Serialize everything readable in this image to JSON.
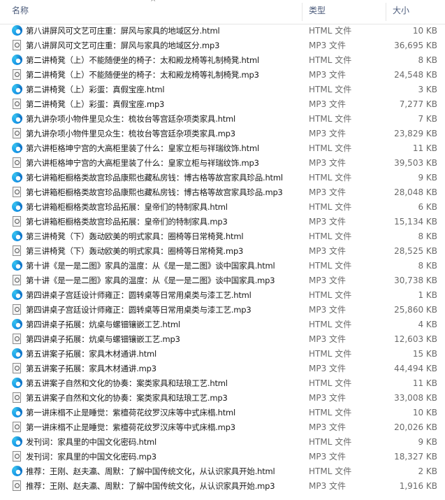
{
  "header": {
    "name": "名称",
    "type": "类型",
    "size": "大小",
    "sort_arrow": "^"
  },
  "files": [
    {
      "name": "第八讲屏风可文艺可庄重：屏风与家具的地域区分.html",
      "type": "HTML 文件",
      "size": "10 KB",
      "icon": "edge-html-icon"
    },
    {
      "name": "第八讲屏风可文艺可庄重：屏风与家具的地域区分.mp3",
      "type": "MP3 文件",
      "size": "36,695 KB",
      "icon": "mp3-file-icon"
    },
    {
      "name": "第二讲椅凳（上）不能随便坐的椅子：太和殿龙椅等礼制椅凳.html",
      "type": "HTML 文件",
      "size": "8 KB",
      "icon": "edge-html-icon"
    },
    {
      "name": "第二讲椅凳（上）不能随便坐的椅子：太和殿龙椅等礼制椅凳.mp3",
      "type": "MP3 文件",
      "size": "24,548 KB",
      "icon": "mp3-file-icon"
    },
    {
      "name": "第二讲椅凳（上）彩蛋：真假宝座.html",
      "type": "HTML 文件",
      "size": "3 KB",
      "icon": "edge-html-icon"
    },
    {
      "name": "第二讲椅凳（上）彩蛋：真假宝座.mp3",
      "type": "MP3 文件",
      "size": "7,277 KB",
      "icon": "mp3-file-icon"
    },
    {
      "name": "第九讲杂项小物件里见众生：梳妆台等宫廷杂项类家具.html",
      "type": "HTML 文件",
      "size": "7 KB",
      "icon": "edge-html-icon"
    },
    {
      "name": "第九讲杂项小物件里见众生：梳妆台等宫廷杂项类家具.mp3",
      "type": "MP3 文件",
      "size": "23,829 KB",
      "icon": "mp3-file-icon"
    },
    {
      "name": "第六讲柜格坤宁宫的大高柜里装了什么：皇家立柜与祥瑞纹饰.html",
      "type": "HTML 文件",
      "size": "11 KB",
      "icon": "edge-html-icon"
    },
    {
      "name": "第六讲柜格坤宁宫的大高柜里装了什么：皇家立柜与祥瑞纹饰.mp3",
      "type": "MP3 文件",
      "size": "39,503 KB",
      "icon": "mp3-file-icon"
    },
    {
      "name": "第七讲箱柜橱格类故宫珍品康熙也藏私房钱：博古格等故宫家具珍品.html",
      "type": "HTML 文件",
      "size": "9 KB",
      "icon": "edge-html-icon"
    },
    {
      "name": "第七讲箱柜橱格类故宫珍品康熙也藏私房钱：博古格等故宫家具珍品.mp3",
      "type": "MP3 文件",
      "size": "28,048 KB",
      "icon": "mp3-file-icon"
    },
    {
      "name": "第七讲箱柜橱格类故宫珍品拓展：皇帝们的特制家具.html",
      "type": "HTML 文件",
      "size": "6 KB",
      "icon": "edge-html-icon"
    },
    {
      "name": "第七讲箱柜橱格类故宫珍品拓展：皇帝们的特制家具.mp3",
      "type": "MP3 文件",
      "size": "15,134 KB",
      "icon": "mp3-file-icon"
    },
    {
      "name": "第三讲椅凳（下）轰动欧美的明式家具：圈椅等日常椅凳.html",
      "type": "HTML 文件",
      "size": "8 KB",
      "icon": "edge-html-icon"
    },
    {
      "name": "第三讲椅凳（下）轰动欧美的明式家具：圈椅等日常椅凳.mp3",
      "type": "MP3 文件",
      "size": "28,525 KB",
      "icon": "mp3-file-icon"
    },
    {
      "name": "第十讲《是一是二图》家具的温度：从《是一是二图》谈中国家具.html",
      "type": "HTML 文件",
      "size": "8 KB",
      "icon": "edge-html-icon"
    },
    {
      "name": "第十讲《是一是二图》家具的温度：从《是一是二图》谈中国家具.mp3",
      "type": "MP3 文件",
      "size": "30,738 KB",
      "icon": "mp3-file-icon"
    },
    {
      "name": "第四讲桌子宫廷设计师雍正：圆转桌等日常用桌类与漆工艺.html",
      "type": "HTML 文件",
      "size": "1 KB",
      "icon": "edge-html-icon"
    },
    {
      "name": "第四讲桌子宫廷设计师雍正：圆转桌等日常用桌类与漆工艺.mp3",
      "type": "MP3 文件",
      "size": "25,860 KB",
      "icon": "mp3-file-icon"
    },
    {
      "name": "第四讲桌子拓展：炕桌与螺钿镶嵌工艺.html",
      "type": "HTML 文件",
      "size": "4 KB",
      "icon": "edge-html-icon"
    },
    {
      "name": "第四讲桌子拓展：炕桌与螺钿镶嵌工艺.mp3",
      "type": "MP3 文件",
      "size": "12,603 KB",
      "icon": "mp3-file-icon"
    },
    {
      "name": "第五讲案子拓展：家具木材通讲.html",
      "type": "HTML 文件",
      "size": "15 KB",
      "icon": "edge-html-icon"
    },
    {
      "name": "第五讲案子拓展：家具木材通讲.mp3",
      "type": "MP3 文件",
      "size": "44,494 KB",
      "icon": "mp3-file-icon"
    },
    {
      "name": "第五讲案子自然和文化的协奏：案类家具和珐琅工艺.html",
      "type": "HTML 文件",
      "size": "11 KB",
      "icon": "edge-html-icon"
    },
    {
      "name": "第五讲案子自然和文化的协奏：案类家具和珐琅工艺.mp3",
      "type": "MP3 文件",
      "size": "33,008 KB",
      "icon": "mp3-file-icon"
    },
    {
      "name": "第一讲床榻不止是睡觉：紫檀荷花纹罗汉床等中式床榻.html",
      "type": "HTML 文件",
      "size": "10 KB",
      "icon": "edge-html-icon"
    },
    {
      "name": "第一讲床榻不止是睡觉：紫檀荷花纹罗汉床等中式床榻.mp3",
      "type": "MP3 文件",
      "size": "20,026 KB",
      "icon": "mp3-file-icon"
    },
    {
      "name": "发刊词：家具里的中国文化密码.html",
      "type": "HTML 文件",
      "size": "9 KB",
      "icon": "edge-html-icon"
    },
    {
      "name": "发刊词：家具里的中国文化密码.mp3",
      "type": "MP3 文件",
      "size": "18,327 KB",
      "icon": "mp3-file-icon"
    },
    {
      "name": "推荐：王刚、赵夫瀛、周默：了解中国传统文化，从认识家具开始.html",
      "type": "HTML 文件",
      "size": "2 KB",
      "icon": "edge-html-icon"
    },
    {
      "name": "推荐：王刚、赵夫瀛、周默：了解中国传统文化，从认识家具开始.mp3",
      "type": "MP3 文件",
      "size": "1,916 KB",
      "icon": "mp3-file-icon"
    }
  ]
}
